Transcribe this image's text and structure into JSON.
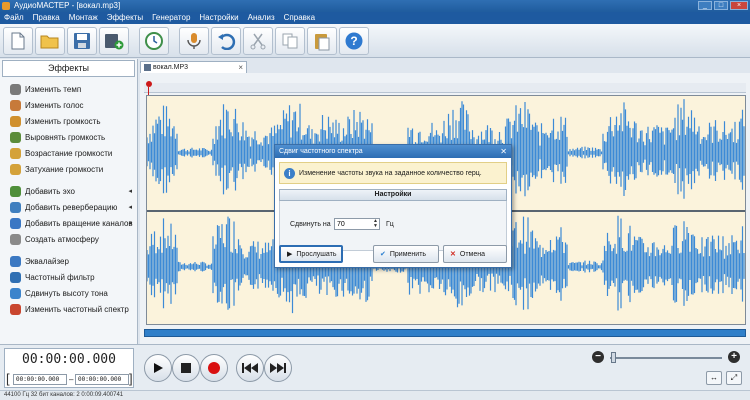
{
  "window": {
    "title": "АудиоМАСТЕР - [вокал.mp3]"
  },
  "menu": [
    "Файл",
    "Правка",
    "Монтаж",
    "Эффекты",
    "Генератор",
    "Настройки",
    "Анализ",
    "Справка"
  ],
  "toolbar": {
    "icons": [
      "new-file-icon",
      "open-folder-icon",
      "save-icon",
      "add-audio-icon",
      "undo-history-icon",
      "record-mic-icon",
      "undo-icon",
      "cut-icon",
      "copy-icon",
      "paste-icon",
      "help-icon"
    ]
  },
  "effects_panel": {
    "header": "Эффекты",
    "items": [
      {
        "label": "Изменить темп",
        "color": "#7a7a7a",
        "arrow": false
      },
      {
        "label": "Изменить голос",
        "color": "#c77a3a",
        "arrow": false
      },
      {
        "label": "Изменить громкость",
        "color": "#d0902e",
        "arrow": false
      },
      {
        "label": "Выровнять громкость",
        "color": "#5b8c3a",
        "arrow": false
      },
      {
        "label": "Возрастание громкости",
        "color": "#d4a23a",
        "arrow": false
      },
      {
        "label": "Затухание громкости",
        "color": "#d4a23a",
        "arrow": false
      },
      {
        "label": "Добавить эхо",
        "color": "#4f8f3a",
        "arrow": true
      },
      {
        "label": "Добавить реверберацию",
        "color": "#3f7fbf",
        "arrow": true
      },
      {
        "label": "Добавить вращение каналов",
        "color": "#3a77c4",
        "arrow": true
      },
      {
        "label": "Создать атмосферу",
        "color": "#8a8a8a",
        "arrow": false
      },
      {
        "label": "Эквалайзер",
        "color": "#3b78c2",
        "arrow": false
      },
      {
        "label": "Частотный фильтр",
        "color": "#2f6fb3",
        "arrow": false
      },
      {
        "label": "Сдвинуть высоту тона",
        "color": "#3c84cc",
        "arrow": false
      },
      {
        "label": "Изменить частотный спектр",
        "color": "#c9462f",
        "arrow": false
      }
    ]
  },
  "tab": {
    "label": "вокал.MP3",
    "close": "×"
  },
  "dialog": {
    "title": "Сдвиг частотного спектра",
    "close": "✕",
    "info": "Изменение частоты звука на заданное количество герц.",
    "section": "Настройки",
    "shift_label": "Сдвинуть на",
    "shift_value": "70",
    "unit": "Гц",
    "listen": "Прослушать",
    "apply": "Применить",
    "cancel": "Отмена"
  },
  "transport": {
    "time": "00:00:00.000",
    "range_start": "00:00:00.000",
    "range_end": "00:00:00.000",
    "dash": "–",
    "bracket_open": "[",
    "bracket_close": "]"
  },
  "zoom": {
    "minus": "−",
    "plus": "+",
    "level": 0.03
  },
  "status": {
    "text": "44100 Гц  32 бит  каналов: 2    0:00:09.400741"
  },
  "colors": {
    "wave": "#3c8ad6",
    "wave_bg": "#fbf3dc",
    "accent": "#2f6fb3",
    "record": "#d91010"
  }
}
